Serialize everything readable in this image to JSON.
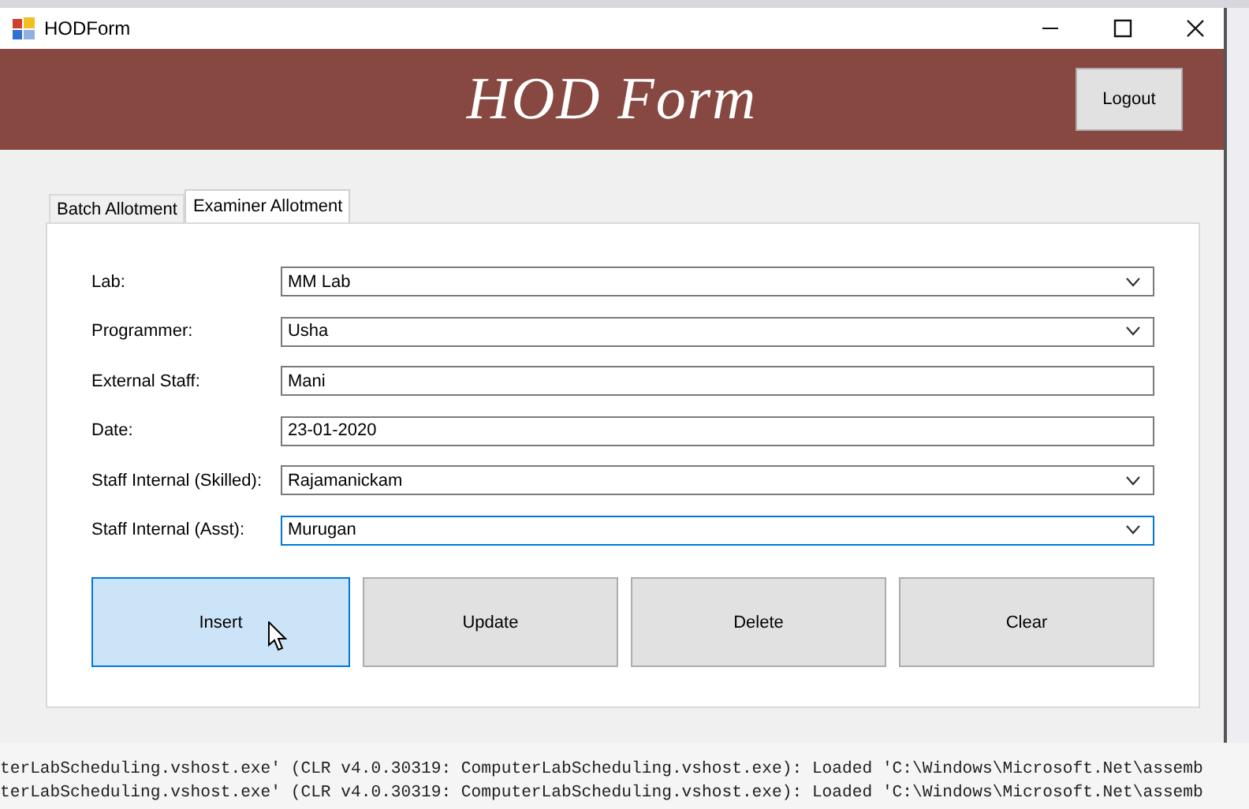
{
  "window": {
    "title": "HODForm"
  },
  "header": {
    "title": "HOD Form",
    "logout": "Logout"
  },
  "tabs": [
    {
      "label": "Batch Allotment",
      "selected": false
    },
    {
      "label": "Examiner Allotment",
      "selected": true
    }
  ],
  "fields": [
    {
      "label": "Lab:",
      "kind": "dropdown",
      "value": "MM Lab",
      "focused": false
    },
    {
      "label": "Programmer:",
      "kind": "dropdown",
      "value": "Usha",
      "focused": false
    },
    {
      "label": "External Staff:",
      "kind": "text",
      "value": "Mani",
      "focused": false
    },
    {
      "label": "Date:",
      "kind": "text",
      "value": "23-01-2020",
      "focused": false
    },
    {
      "label": "Staff Internal (Skilled):",
      "kind": "dropdown",
      "value": "Rajamanickam",
      "focused": false
    },
    {
      "label": "Staff Internal (Asst):",
      "kind": "dropdown",
      "value": "Murugan",
      "focused": true
    }
  ],
  "buttons": [
    {
      "label": "Insert",
      "highlighted": true
    },
    {
      "label": "Update",
      "highlighted": false
    },
    {
      "label": "Delete",
      "highlighted": false
    },
    {
      "label": "Clear",
      "highlighted": false
    }
  ],
  "output_lines": [
    "terLabScheduling.vshost.exe' (CLR v4.0.30319: ComputerLabScheduling.vshost.exe): Loaded 'C:\\Windows\\Microsoft.Net\\assemb",
    "terLabScheduling.vshost.exe' (CLR v4.0.30319: ComputerLabScheduling.vshost.exe): Loaded 'C:\\Windows\\Microsoft.Net\\assemb"
  ]
}
